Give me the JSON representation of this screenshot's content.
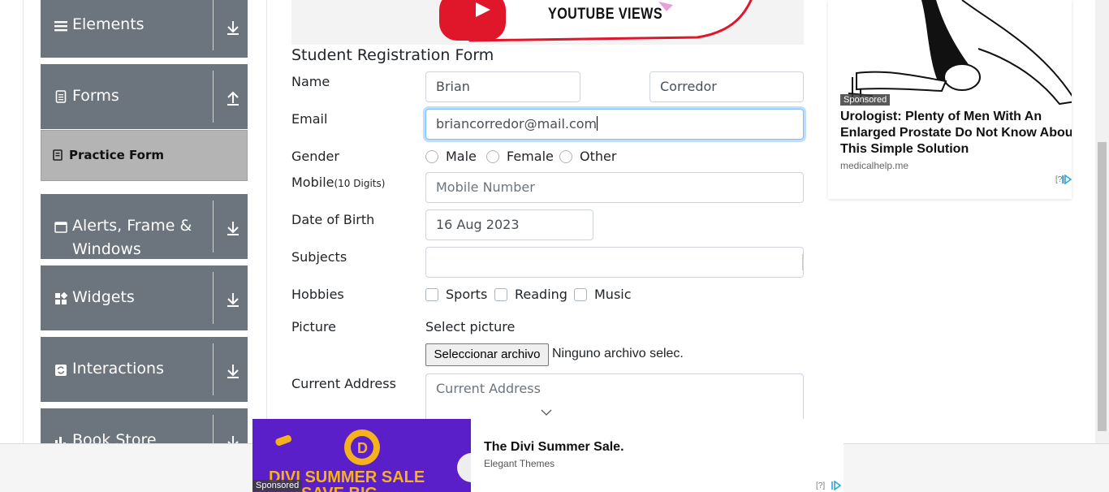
{
  "sidebar": {
    "groups": [
      {
        "label": "Elements",
        "icon": "hamburger-icon",
        "arrow": "download-arrow-icon"
      },
      {
        "label": "Forms",
        "icon": "document-icon",
        "arrow": "upload-arrow-icon"
      },
      {
        "label": "Alerts, Frame &",
        "label2": "Windows",
        "icon": "window-icon",
        "arrow": "download-arrow-icon"
      },
      {
        "label": "Widgets",
        "icon": "widgets-icon",
        "arrow": "download-arrow-icon"
      },
      {
        "label": "Interactions",
        "icon": "interactions-icon",
        "arrow": "download-arrow-icon"
      },
      {
        "label": "Book Store",
        "icon": "bar-chart-icon",
        "arrow": "download-arrow-icon"
      }
    ],
    "active_item": "Practice Form"
  },
  "banner": {
    "text": "YOUTUBE VIEWS"
  },
  "form": {
    "title": "Student Registration Form",
    "name_label": "Name",
    "first_name": "Brian",
    "last_name": "Corredor",
    "email_label": "Email",
    "email_value": "briancorredor@mail.com",
    "gender_label": "Gender",
    "gender_options": [
      "Male",
      "Female",
      "Other"
    ],
    "mobile_label": "Mobile",
    "mobile_hint": "(10 Digits)",
    "mobile_placeholder": "Mobile Number",
    "dob_label": "Date of Birth",
    "dob_value": "16 Aug 2023",
    "subjects_label": "Subjects",
    "hobbies_label": "Hobbies",
    "hobbies_options": [
      "Sports",
      "Reading",
      "Music"
    ],
    "picture_label": "Picture",
    "picture_select": "Select picture",
    "file_button": "Seleccionar archivo",
    "file_status": "Ninguno archivo selec.",
    "address_label": "Current Address",
    "address_placeholder": "Current Address"
  },
  "right_ad": {
    "badge": "Sponsored",
    "headline": "Urologist: Plenty of Men With An Enlarged Prostate Do Not Know About This Simple Solution",
    "domain": "medicalhelp.me",
    "help": "[?]"
  },
  "bottom_ad": {
    "badge": "Sponsored",
    "image_text": "DIVI SUMMER SALE",
    "image_text2": "SAVE BIG",
    "title": "The Divi Summer Sale.",
    "subtitle": "Elegant Themes",
    "help": "[?]"
  },
  "colors": {
    "sidebar": "#6c757d",
    "active": "#b4b4b4",
    "focus": "#80bdff",
    "ad_purple": "#5b1fc9"
  }
}
